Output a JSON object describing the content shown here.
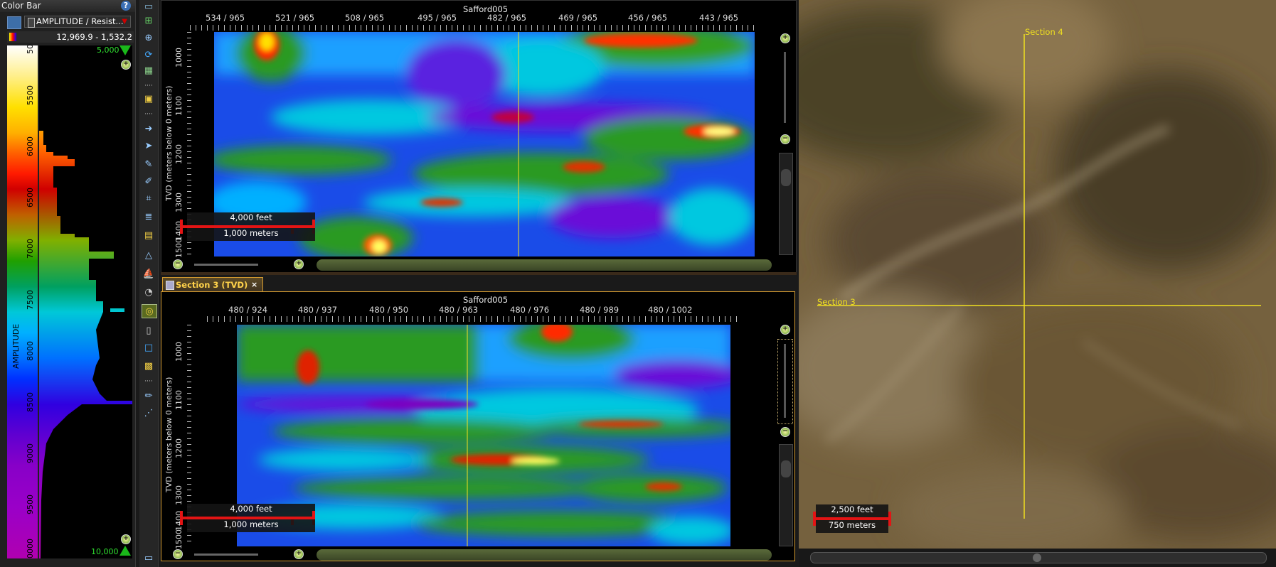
{
  "colorbar": {
    "title": "Color Bar",
    "help": "?",
    "attribute": "AMPLITUDE / Resist...",
    "range": "12,969.9 - 1,532.2",
    "axis_label": "AMPLITUDE",
    "ticks": [
      "50",
      "5500",
      "6000",
      "6500",
      "7000",
      "7500",
      "8000",
      "8500",
      "9000",
      "9500",
      "0000"
    ],
    "top_value": "5,000",
    "bottom_value": "10,000"
  },
  "section4": {
    "title": "Safford005",
    "ticks": [
      "534 / 965",
      "521 / 965",
      "508 / 965",
      "495 / 965",
      "482 / 965",
      "469 / 965",
      "456 / 965",
      "443 / 965"
    ],
    "ylabel": "TVD (meters below 0 meters)",
    "yticks": [
      "1000",
      "1100",
      "1200",
      "1300",
      "1400",
      "1500"
    ],
    "scale_feet": "4,000 feet",
    "scale_meters": "1,000 meters"
  },
  "section3": {
    "tab_label": "Section 3 (TVD)",
    "close": "×",
    "title": "Safford005",
    "ticks": [
      "480 / 924",
      "480 / 937",
      "480 / 950",
      "480 / 963",
      "480 / 976",
      "480 / 989",
      "480 / 1002"
    ],
    "ylabel": "TVD (meters below 0 meters)",
    "yticks": [
      "1000",
      "1100",
      "1200",
      "1300",
      "1400",
      "1500"
    ],
    "scale_feet": "4,000 feet",
    "scale_meters": "1,000 meters"
  },
  "map": {
    "section4_label": "Section 4",
    "section3_label": "Section 3",
    "scale_feet": "2,500 feet",
    "scale_meters": "750 meters",
    "line_color": "#f0e020"
  }
}
